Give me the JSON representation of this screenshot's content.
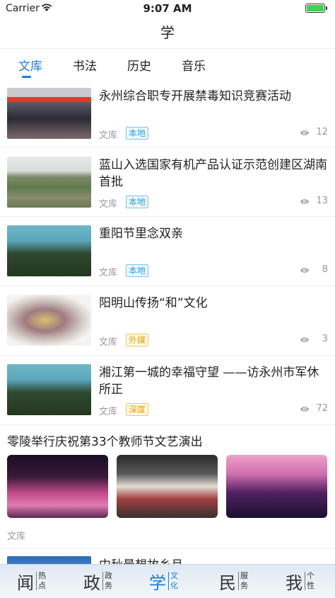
{
  "status_bar": {
    "carrier": "Carrier",
    "time": "9:07 AM"
  },
  "nav": {
    "title": "学"
  },
  "tabs": [
    "文库",
    "书法",
    "历史",
    "音乐"
  ],
  "active_tab": "文库",
  "articles": [
    {
      "title": "永州综合职专开展禁毒知识竞赛活动",
      "source": "文库",
      "tag": "本地",
      "tag_color": "blue",
      "views": "12"
    },
    {
      "title": "蓝山入选国家有机产品认证示范创建区湖南首批",
      "source": "文库",
      "tag": "本地",
      "tag_color": "blue",
      "views": "13"
    },
    {
      "title": "重阳节里念双亲",
      "source": "文库",
      "tag": "本地",
      "tag_color": "blue",
      "views": "8"
    },
    {
      "title": "阳明山传扬“和”文化",
      "source": "文库",
      "tag": "外媒",
      "tag_color": "orange",
      "views": "3"
    },
    {
      "title": "湘江第一城的幸福守望 ——访永州市军休所正",
      "source": "文库",
      "tag": "深度",
      "tag_color": "orange",
      "views": "72"
    }
  ],
  "gallery": {
    "title": "零陵举行庆祝第33个教师节文艺演出",
    "source": "文库"
  },
  "partial_item": {
    "title": "中秋最想故乡月"
  },
  "tab_bar": [
    {
      "big": "闻",
      "small": "热点"
    },
    {
      "big": "政",
      "small": "政务"
    },
    {
      "big": "学",
      "small": "文化"
    },
    {
      "big": "民",
      "small": "服务"
    },
    {
      "big": "我",
      "small": "个性"
    }
  ],
  "colors": {
    "accent": "#1b7fd6",
    "tag_blue": "#2a9ed4",
    "tag_orange": "#e6a100"
  },
  "icons": [
    "wifi-icon",
    "battery-icon",
    "eye-icon"
  ]
}
